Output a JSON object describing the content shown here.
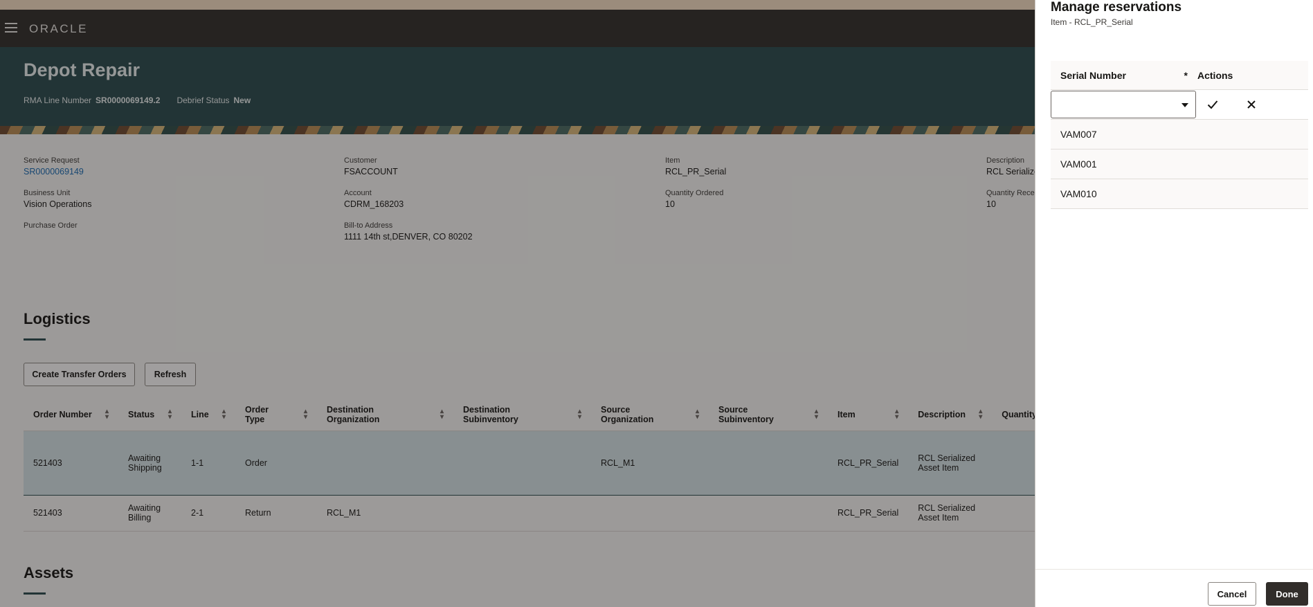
{
  "appbar": {
    "logo": "ORACLE"
  },
  "header": {
    "title": "Depot Repair",
    "rma_label": "RMA Line Number",
    "rma_value": "SR0000069149.2",
    "debrief_label": "Debrief Status",
    "debrief_value": "New"
  },
  "details": {
    "service_request": {
      "label": "Service Request",
      "value": "SR0000069149"
    },
    "customer": {
      "label": "Customer",
      "value": "FSACCOUNT"
    },
    "item": {
      "label": "Item",
      "value": "RCL_PR_Serial"
    },
    "description": {
      "label": "Description",
      "value": "RCL Serialize"
    },
    "business_unit": {
      "label": "Business Unit",
      "value": "Vision Operations"
    },
    "account": {
      "label": "Account",
      "value": "CDRM_168203"
    },
    "quantity_ordered": {
      "label": "Quantity Ordered",
      "value": "10"
    },
    "quantity_received": {
      "label": "Quantity Rece",
      "value": "10"
    },
    "purchase_order": {
      "label": "Purchase Order"
    },
    "bill_to": {
      "label": "Bill-to Address",
      "value": "1111 14th st,DENVER, CO 80202"
    }
  },
  "logistics": {
    "title": "Logistics",
    "create_button": "Create Transfer Orders",
    "refresh_button": "Refresh",
    "columns": [
      "Order Number",
      "Status",
      "Line",
      "Order Type",
      "Destination Organization",
      "Destination Subinventory",
      "Source Organization",
      "Source Subinventory",
      "Item",
      "Description",
      "Quantity"
    ],
    "rows": [
      {
        "order_number": "521403",
        "status": "Awaiting Shipping",
        "line": "1-1",
        "order_type": "Order",
        "dest_org": "",
        "dest_sub": "",
        "source_org": "RCL_M1",
        "source_sub": "",
        "item": "RCL_PR_Serial",
        "description": "RCL Serialized Asset Item",
        "quantity": ""
      },
      {
        "order_number": "521403",
        "status": "Awaiting Billing",
        "line": "2-1",
        "order_type": "Return",
        "dest_org": "RCL_M1",
        "dest_sub": "",
        "source_org": "",
        "source_sub": "",
        "item": "RCL_PR_Serial",
        "description": "RCL Serialized Asset Item",
        "quantity": ""
      }
    ]
  },
  "assets": {
    "title": "Assets"
  },
  "drawer": {
    "title": "Manage reservations",
    "subtitle": "Item - RCL_PR_Serial",
    "col_serial": "Serial Number",
    "required_mark": "*",
    "col_actions": "Actions",
    "serials": [
      "VAM007",
      "VAM001",
      "VAM010"
    ],
    "cancel": "Cancel",
    "done": "Done"
  }
}
